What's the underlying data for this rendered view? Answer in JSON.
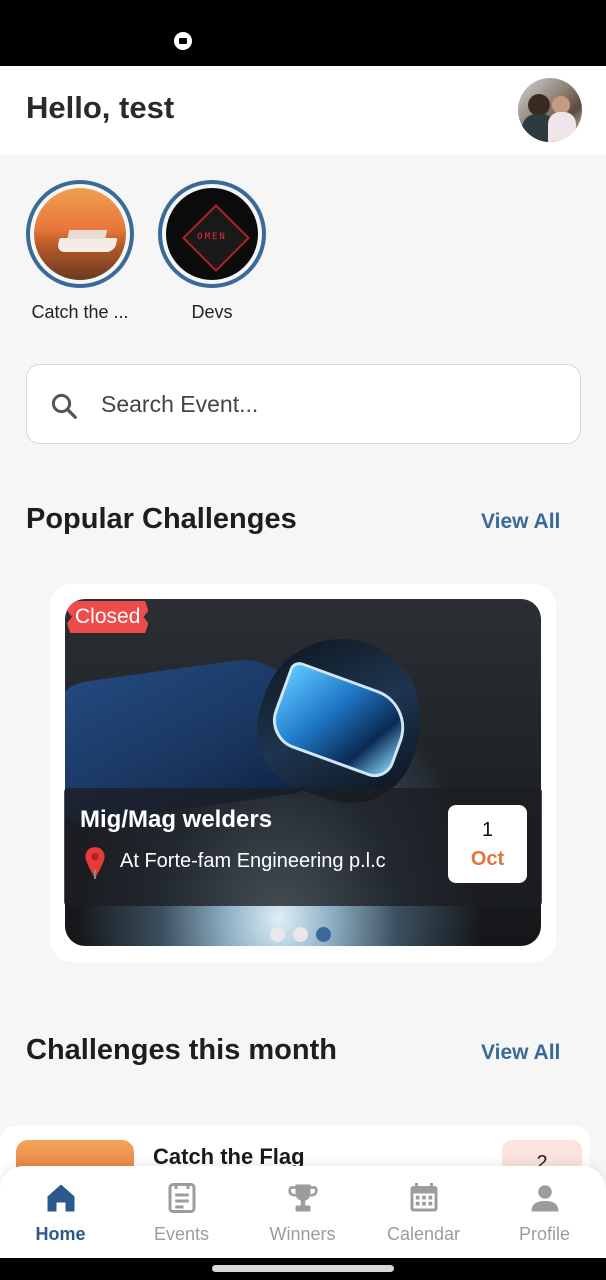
{
  "header": {
    "greeting": "Hello, test"
  },
  "stories": [
    {
      "label": "Catch the ...",
      "image": "cruise-ship-sunset"
    },
    {
      "label": "Devs",
      "image": "omen-logo",
      "logo_text": "OMEN"
    }
  ],
  "search": {
    "placeholder": "Search Event..."
  },
  "popular": {
    "title": "Popular Challenges",
    "view_all": "View All",
    "card": {
      "badge": "Closed",
      "title": "Mig/Mag welders",
      "location": "At Forte-fam Engineering p.l.c",
      "date_day": "1",
      "date_month": "Oct",
      "carousel_active_index": 2,
      "carousel_count": 3
    }
  },
  "month": {
    "title": "Challenges this month",
    "view_all": "View All",
    "first_item": {
      "name": "Catch the Flag",
      "date_day": "2"
    }
  },
  "nav": [
    {
      "label": "Home",
      "icon": "home-icon",
      "active": true
    },
    {
      "label": "Events",
      "icon": "events-icon",
      "active": false
    },
    {
      "label": "Winners",
      "icon": "trophy-icon",
      "active": false
    },
    {
      "label": "Calendar",
      "icon": "calendar-icon",
      "active": false
    },
    {
      "label": "Profile",
      "icon": "profile-icon",
      "active": false
    }
  ],
  "colors": {
    "accent": "#3a6a9a",
    "nav_active": "#2a5a8c",
    "badge_red": "#ee4c4c",
    "month_orange": "#e3743f"
  }
}
